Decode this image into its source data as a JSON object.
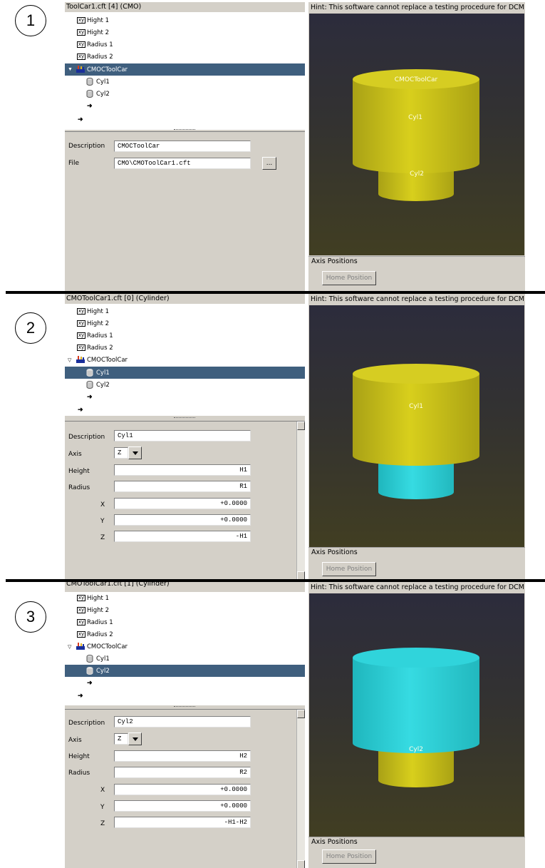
{
  "steps": [
    "1",
    "2",
    "3"
  ],
  "hint": "Hint: This software cannot replace a testing procedure for DCM",
  "axis_positions_title": "Axis Positions",
  "home_button_label": "Home Position",
  "tree_items": {
    "param1": "Hight 1",
    "param2": "Hight 2",
    "param3": "Radius 1",
    "param4": "Radius 2",
    "group": "CMOCToolCar",
    "cyl1": "Cyl1",
    "cyl2": "Cyl2"
  },
  "param_icon_text": "xy",
  "labels": {
    "description": "Description",
    "file": "File",
    "axis": "Axis",
    "height": "Height",
    "radius": "Radius",
    "x": "X",
    "y": "Y",
    "z": "Z",
    "browse": "..."
  },
  "icons": {
    "param": "xy-param-icon",
    "group": "toolcar-group-icon",
    "cylinder": "cylinder-icon",
    "add": "arrow-right-icon",
    "expand": "triangle-down-icon",
    "dropdown": "chevron-down-icon",
    "scroll_up": "scroll-up-icon",
    "scroll_down": "scroll-down-icon"
  },
  "colors": {
    "selection": "#3f5f7e",
    "yellow_cylinder": "#cfc61a",
    "cyan_cylinder": "#2cd2d9",
    "panel_bg": "#d4d0c8"
  },
  "panels": [
    {
      "title": "ToolCar1.cft   [4]  (CMO)",
      "selected": "group",
      "description": "CMOCToolCar",
      "file": "CMO\\CMOToolCar1.cft",
      "cyl_labels": {
        "top": "CMOCToolCar",
        "upper": "Cyl1",
        "lower": "Cyl2"
      }
    },
    {
      "title": "CMOToolCar1.cft   [0]  (Cylinder)",
      "selected": "cyl1",
      "description": "Cyl1",
      "axis": "Z",
      "height": "H1",
      "radius": "R1",
      "x": "+0.0000",
      "y": "+0.0000",
      "z": "-H1",
      "cyl_labels": {
        "upper": "Cyl1"
      }
    },
    {
      "title": "CMOToolCar1.cft   [1]  (Cylinder)",
      "selected": "cyl2",
      "description": "Cyl2",
      "axis": "Z",
      "height": "H2",
      "radius": "R2",
      "x": "+0.0000",
      "y": "+0.0000",
      "z": "-H1-H2",
      "cyl_labels": {
        "lower": "Cyl2"
      }
    }
  ]
}
